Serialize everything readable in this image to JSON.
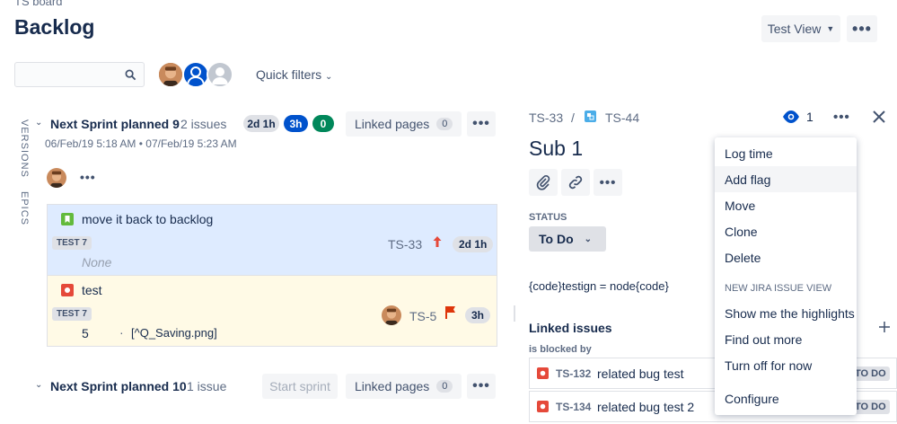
{
  "header": {
    "breadcrumb": "TS board",
    "title": "Backlog",
    "view_button": "Test View"
  },
  "filters": {
    "search_placeholder": "",
    "quick_filters": "Quick filters"
  },
  "sidebar": {
    "versions": "VERSIONS",
    "epics": "EPICS"
  },
  "sprint1": {
    "name": "Next Sprint planned 9",
    "count": "2 issues",
    "pills": [
      "2d 1h",
      "3h",
      "0"
    ],
    "linked_pages": "Linked pages",
    "linked_count": "0",
    "dates": "06/Feb/19 5:18 AM • 07/Feb/19 5:23 AM",
    "issues": [
      {
        "summary": "move it back to backlog",
        "epic": "TEST 7",
        "sub": "None",
        "key": "TS-33",
        "estimate": "2d 1h",
        "type_color": "#63ba3c",
        "bg": "#deebff"
      },
      {
        "summary": "test",
        "epic": "TEST 7",
        "sub_num": "5",
        "sub_text": "[^Q_Saving.png]",
        "key": "TS-5",
        "estimate": "3h",
        "type_color": "#e5493a",
        "bg": "#fffae6"
      }
    ]
  },
  "sprint2": {
    "name": "Next Sprint planned 10",
    "count": "1 issue",
    "start": "Start sprint",
    "linked_pages": "Linked pages",
    "linked_count": "0"
  },
  "detail": {
    "parent_key": "TS-33",
    "sep": "/",
    "key": "TS-44",
    "watch_count": "1",
    "title": "Sub 1",
    "status_label": "STATUS",
    "status": "To Do",
    "description": "{code}testign = node{code}",
    "linked_heading": "Linked issues",
    "blocked_by": "is blocked by",
    "links": [
      {
        "key": "TS-132",
        "summary": "related bug test",
        "status": "TO DO"
      },
      {
        "key": "TS-134",
        "summary": "related bug test 2",
        "status": "TO DO"
      }
    ]
  },
  "menu": {
    "items": [
      "Log time",
      "Add flag",
      "Move",
      "Clone",
      "Delete"
    ],
    "section": "NEW JIRA ISSUE VIEW",
    "items2": [
      "Show me the highlights",
      "Find out more",
      "Turn off for now"
    ],
    "configure": "Configure"
  },
  "colors": {
    "accent": "#0052cc",
    "green": "#00875a",
    "bug": "#e5493a",
    "story": "#63ba3c",
    "subtask": "#4bade8"
  }
}
